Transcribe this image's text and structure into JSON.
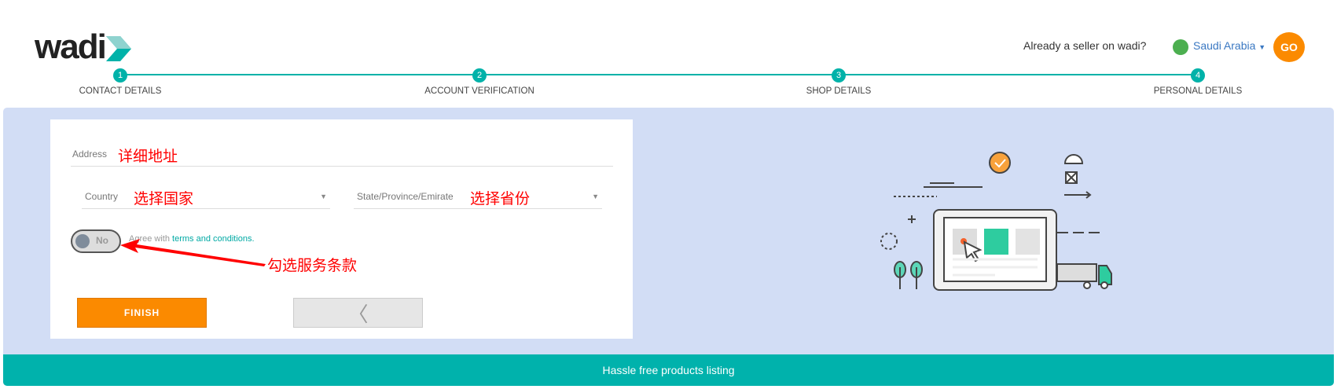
{
  "header": {
    "logo_text": "wadi",
    "seller_prompt": "Already a seller on wadi?",
    "country": "Saudi Arabia",
    "go_label": "GO"
  },
  "steps": [
    {
      "num": "1",
      "label": "CONTACT DETAILS"
    },
    {
      "num": "2",
      "label": "ACCOUNT VERIFICATION"
    },
    {
      "num": "3",
      "label": "SHOP DETAILS"
    },
    {
      "num": "4",
      "label": "PERSONAL DETAILS"
    }
  ],
  "form": {
    "address_label": "Address",
    "address_note": "详细地址",
    "country_label": "Country",
    "country_note": "选择国家",
    "state_label": "State/Province/Emirate",
    "state_note": "选择省份",
    "toggle_state": "No",
    "agree_prefix": "Agree with ",
    "agree_link": "terms and conditions.",
    "toggle_note": "勾选服务条款",
    "finish_label": "FINISH",
    "back_label": "〈"
  },
  "banner": "Hassle free products listing",
  "colors": {
    "accent": "#00b2a9",
    "orange": "#fb8a00",
    "panel": "#d2ddf5"
  }
}
